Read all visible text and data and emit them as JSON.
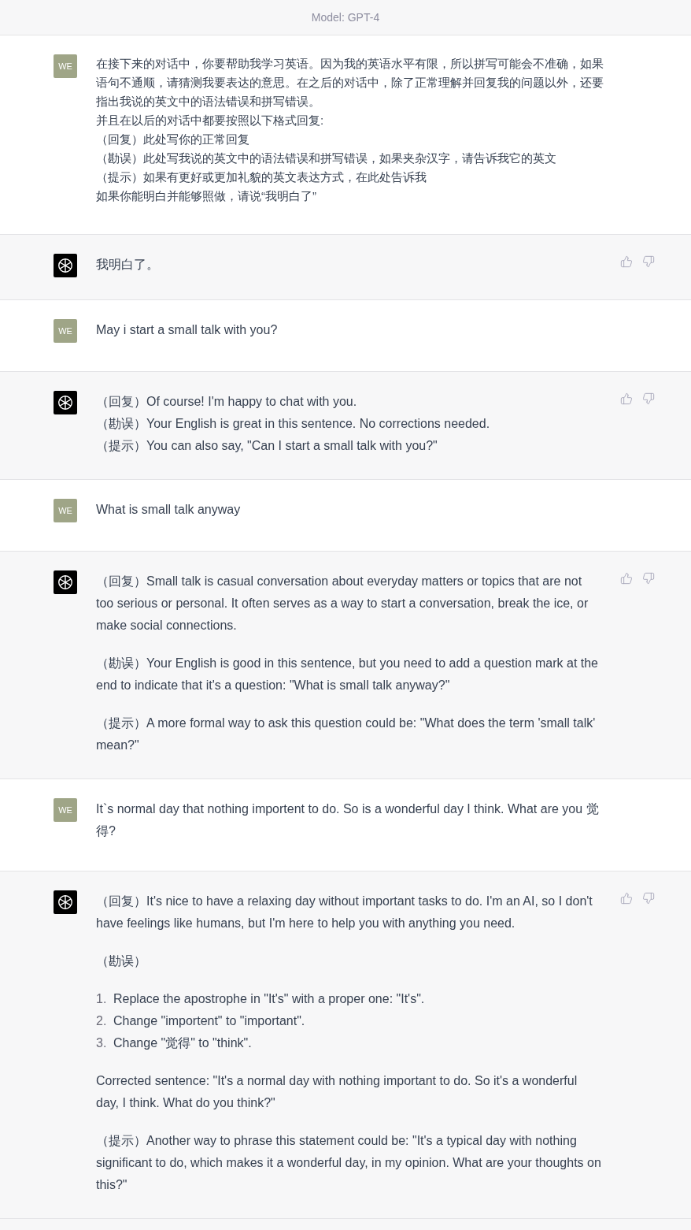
{
  "header": {
    "title": "Model: GPT-4"
  },
  "messages": [
    {
      "kind": "user",
      "avatar": "WE",
      "blocks": [
        {
          "kind": "lines",
          "lines": [
            "在接下来的对话中，你要帮助我学习英语。因为我的英语水平有限，所以拼写可能会不准确，如果语句不通顺，请猜测我要表达的意思。在之后的对话中，除了正常理解并回复我的问题以外，还要指出我说的英文中的语法错误和拼写错误。",
            "并且在以后的对话中都要按照以下格式回复:",
            "（回复）此处写你的正常回复",
            "（勘误）此处写我说的英文中的语法错误和拼写错误，如果夹杂汉字，请告诉我它的英文",
            "（提示）如果有更好或更加礼貌的英文表达方式，在此处告诉我",
            "如果你能明白并能够照做，请说“我明白了”"
          ]
        }
      ]
    },
    {
      "kind": "assistant",
      "blocks": [
        {
          "kind": "para",
          "text": "我明白了。"
        }
      ]
    },
    {
      "kind": "user",
      "avatar": "WE",
      "blocks": [
        {
          "kind": "para",
          "text": "May i start a small talk with you?"
        }
      ]
    },
    {
      "kind": "assistant",
      "blocks": [
        {
          "kind": "lines",
          "lines": [
            "（回复）Of course! I'm happy to chat with you.",
            "（勘误）Your English is great in this sentence. No corrections needed.",
            "（提示）You can also say, \"Can I start a small talk with you?\""
          ]
        }
      ]
    },
    {
      "kind": "user",
      "avatar": "WE",
      "blocks": [
        {
          "kind": "para",
          "text": "What is small talk anyway"
        }
      ]
    },
    {
      "kind": "assistant",
      "blocks": [
        {
          "kind": "para",
          "text": "（回复）Small talk is casual conversation about everyday matters or topics that are not too serious or personal. It often serves as a way to start a conversation, break the ice, or make social connections."
        },
        {
          "kind": "para",
          "text": "（勘误）Your English is good in this sentence, but you need to add a question mark at the end to indicate that it's a question: \"What is small talk anyway?\""
        },
        {
          "kind": "para",
          "text": "（提示）A more formal way to ask this question could be: \"What does the term 'small talk' mean?\""
        }
      ]
    },
    {
      "kind": "user",
      "avatar": "WE",
      "blocks": [
        {
          "kind": "para",
          "text": "It`s normal day that nothing importent to do. So is a wonderful day I think. What are you 觉得?"
        }
      ]
    },
    {
      "kind": "assistant",
      "blocks": [
        {
          "kind": "para",
          "text": "（回复）It's nice to have a relaxing day without important tasks to do. I'm an AI, so I don't have feelings like humans, but I'm here to help you with anything you need."
        },
        {
          "kind": "para",
          "text": "（勘误）"
        },
        {
          "kind": "list",
          "items": [
            {
              "number": "1.",
              "text": "Replace the apostrophe in \"It's\" with a proper one: \"It's\"."
            },
            {
              "number": "2.",
              "text": "Change \"importent\" to \"important\"."
            },
            {
              "number": "3.",
              "text": "Change \"觉得\" to \"think\"."
            }
          ]
        },
        {
          "kind": "para",
          "text": "Corrected sentence: \"It's a normal day with nothing important to do. So it's a wonderful day, I think. What do you think?\""
        },
        {
          "kind": "para",
          "text": "（提示）Another way to phrase this statement could be: \"It's a typical day with nothing significant to do, which makes it a wonderful day, in my opinion. What are your thoughts on this?\""
        }
      ]
    }
  ]
}
